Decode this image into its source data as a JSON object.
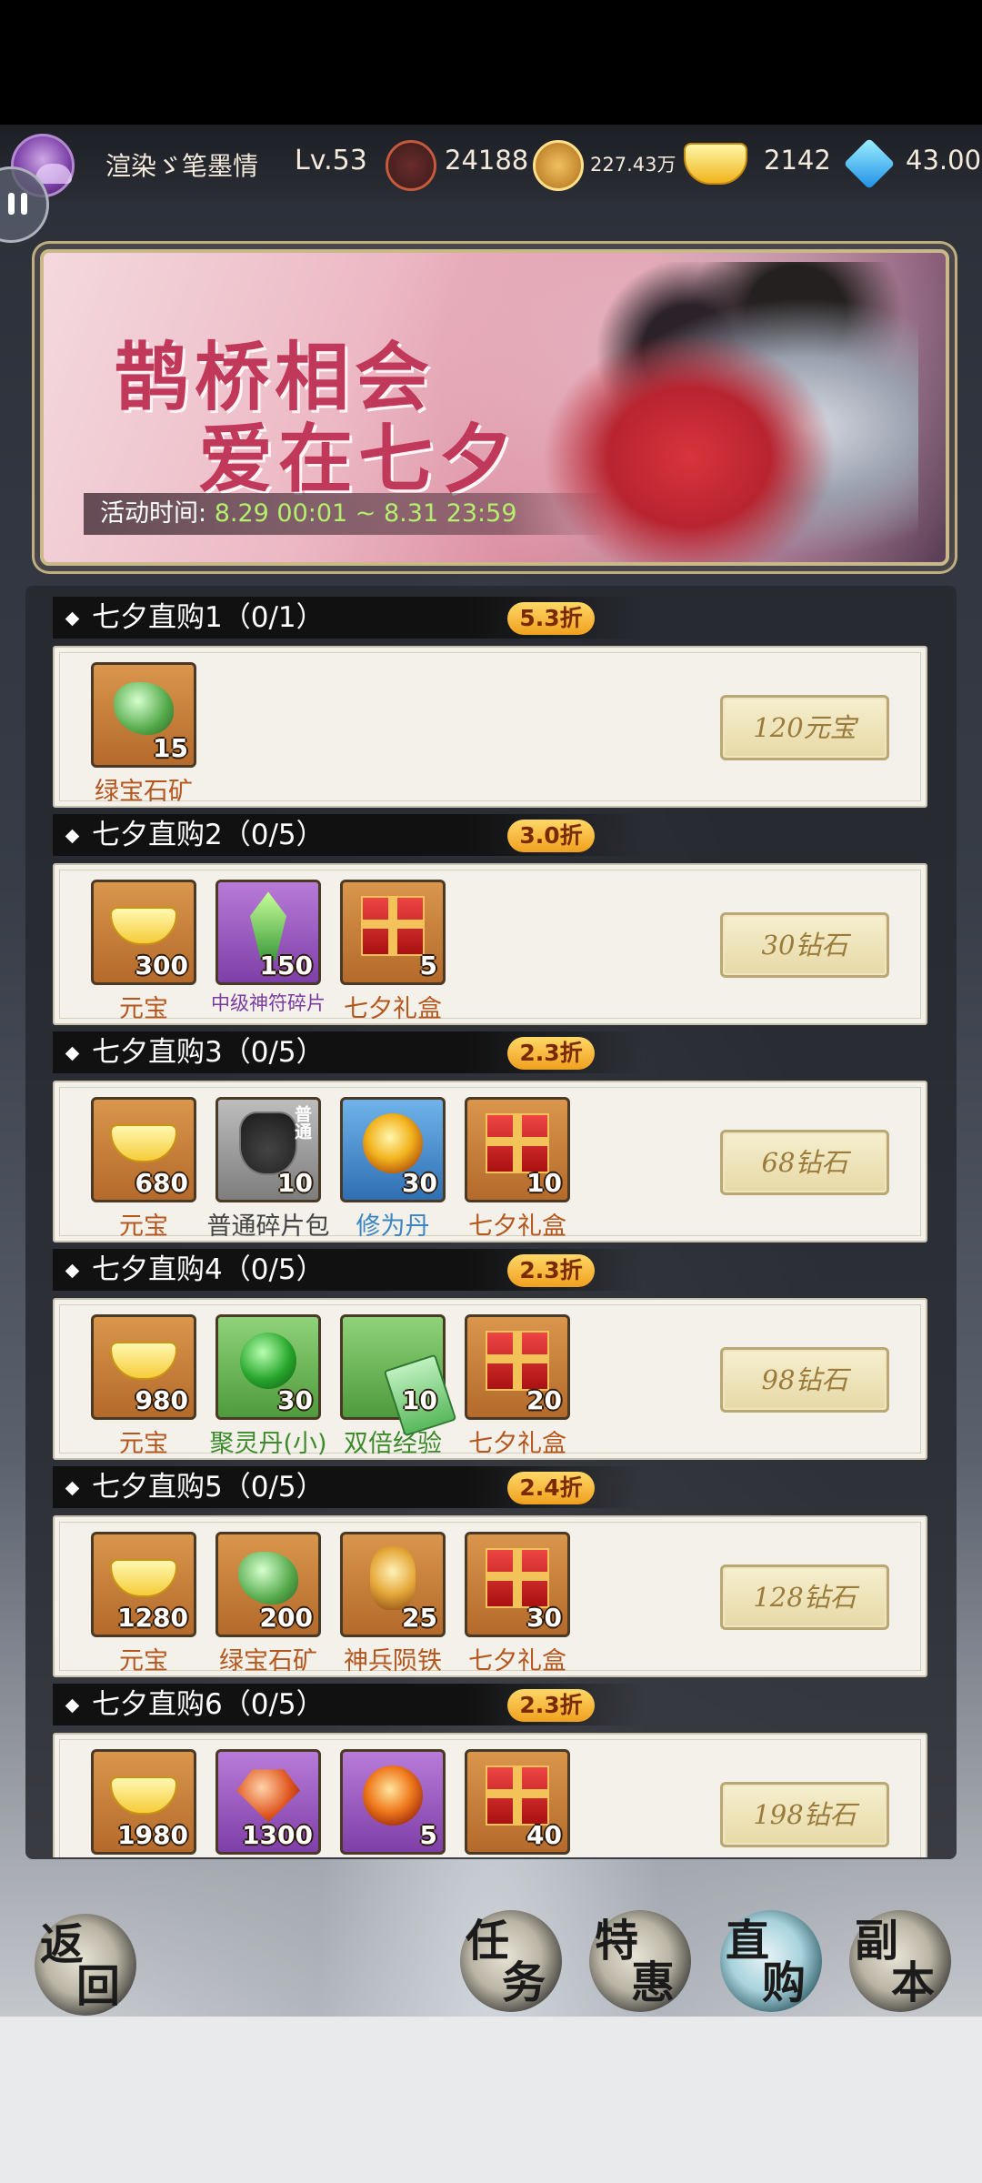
{
  "player": {
    "name": "渲染ゞ笔墨情",
    "level": "Lv.53",
    "power": "24188",
    "coins": "227.43万",
    "ingots": "2142",
    "diamonds": "43.00"
  },
  "banner": {
    "title_line1": "鹊桥相会",
    "title_line2": "爱在七夕",
    "time_label": "活动时间:",
    "time_value": "8.29 00:01 ~ 8.31 23:59"
  },
  "packs": [
    {
      "title": "七夕直购1（0/1）",
      "discount": "5.3折",
      "price": "120元宝",
      "items": [
        {
          "name": "绿宝石矿",
          "count": "15",
          "icon": "green-ore-icon",
          "frame": "orange",
          "art": "art-gem",
          "name_color": "c-orange"
        }
      ]
    },
    {
      "title": "七夕直购2（0/5）",
      "discount": "3.0折",
      "price": "30钻石",
      "items": [
        {
          "name": "元宝",
          "count": "300",
          "icon": "gold-ingot-icon",
          "frame": "orange",
          "art": "art-gold",
          "name_color": "c-orange"
        },
        {
          "name": "中级神符碎片",
          "count": "150",
          "icon": "rune-shard-icon",
          "frame": "purple",
          "art": "art-crystal",
          "name_color": "c-purple"
        },
        {
          "name": "七夕礼盒",
          "count": "5",
          "icon": "gift-box-icon",
          "frame": "orange",
          "art": "art-giftbox",
          "name_color": "c-orange"
        }
      ]
    },
    {
      "title": "七夕直购3（0/5）",
      "discount": "2.3折",
      "price": "68钻石",
      "items": [
        {
          "name": "元宝",
          "count": "680",
          "icon": "gold-ingot-icon",
          "frame": "orange",
          "art": "art-gold",
          "name_color": "c-orange"
        },
        {
          "name": "普通碎片包",
          "count": "10",
          "icon": "shard-pouch-icon",
          "frame": "grey",
          "art": "art-pouch",
          "name_color": "c-dark",
          "tag": "普通"
        },
        {
          "name": "修为丹",
          "count": "30",
          "icon": "cultivation-pill-icon",
          "frame": "blue",
          "art": "art-orb",
          "name_color": "c-blue"
        },
        {
          "name": "七夕礼盒",
          "count": "10",
          "icon": "gift-box-icon",
          "frame": "orange",
          "art": "art-giftbox",
          "name_color": "c-orange"
        }
      ]
    },
    {
      "title": "七夕直购4（0/5）",
      "discount": "2.3折",
      "price": "98钻石",
      "items": [
        {
          "name": "元宝",
          "count": "980",
          "icon": "gold-ingot-icon",
          "frame": "orange",
          "art": "art-gold",
          "name_color": "c-orange"
        },
        {
          "name": "聚灵丹(小)",
          "count": "30",
          "icon": "spirit-pill-icon",
          "frame": "green",
          "art": "art-greenorb",
          "name_color": "c-green"
        },
        {
          "name": "双倍经验",
          "count": "10",
          "icon": "double-exp-ticket-icon",
          "frame": "green",
          "art": "art-ticket",
          "name_color": "c-green"
        },
        {
          "name": "七夕礼盒",
          "count": "20",
          "icon": "gift-box-icon",
          "frame": "orange",
          "art": "art-giftbox",
          "name_color": "c-orange"
        }
      ]
    },
    {
      "title": "七夕直购5（0/5）",
      "discount": "2.4折",
      "price": "128钻石",
      "items": [
        {
          "name": "元宝",
          "count": "1280",
          "icon": "gold-ingot-icon",
          "frame": "orange",
          "art": "art-gold",
          "name_color": "c-orange"
        },
        {
          "name": "绿宝石矿",
          "count": "200",
          "icon": "green-ore-icon",
          "frame": "orange",
          "art": "art-gem",
          "name_color": "c-orange"
        },
        {
          "name": "神兵陨铁",
          "count": "25",
          "icon": "meteoric-iron-icon",
          "frame": "orange",
          "art": "art-iron",
          "name_color": "c-orange"
        },
        {
          "name": "七夕礼盒",
          "count": "30",
          "icon": "gift-box-icon",
          "frame": "orange",
          "art": "art-giftbox",
          "name_color": "c-orange"
        }
      ]
    },
    {
      "title": "七夕直购6（0/5）",
      "discount": "2.3折",
      "price": "198钻石",
      "items": [
        {
          "name": "",
          "count": "1980",
          "icon": "gold-ingot-icon",
          "frame": "orange",
          "art": "art-gold",
          "name_color": "c-orange"
        },
        {
          "name": "",
          "count": "1300",
          "icon": "fire-gem-icon",
          "frame": "purple",
          "art": "art-redgem",
          "name_color": "c-purple"
        },
        {
          "name": "",
          "count": "5",
          "icon": "fire-orb-icon",
          "frame": "purple",
          "art": "art-orb fire",
          "name_color": "c-purple"
        },
        {
          "name": "",
          "count": "40",
          "icon": "gift-box-icon",
          "frame": "orange",
          "art": "art-giftbox",
          "name_color": "c-orange"
        }
      ]
    }
  ],
  "nav": {
    "back": [
      "返",
      "回"
    ],
    "task": [
      "任",
      "务"
    ],
    "special": [
      "特",
      "惠"
    ],
    "direct": [
      "直",
      "购"
    ],
    "dungeon": [
      "副",
      "本"
    ]
  }
}
